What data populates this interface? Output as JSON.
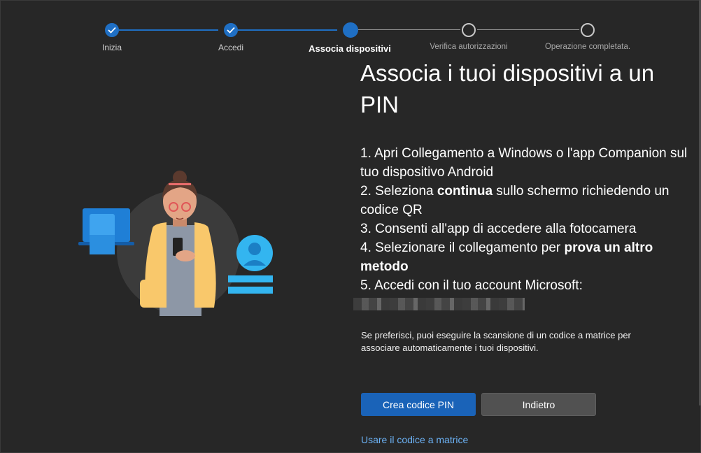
{
  "stepper": {
    "steps": [
      {
        "label": "Inizia",
        "state": "done"
      },
      {
        "label": "Accedi",
        "state": "done"
      },
      {
        "label": "Associa dispositivi",
        "state": "current"
      },
      {
        "label": "Verifica autorizzazioni",
        "state": "todo"
      },
      {
        "label": "Operazione completata.",
        "state": "todo"
      }
    ]
  },
  "main": {
    "title": "Associa i tuoi dispositivi a un PIN",
    "step1": "1. Apri Collegamento a Windows o l'app Companion sul tuo dispositivo Android",
    "step2_prefix": "2. Seleziona ",
    "step2_bold": "continua",
    "step2_suffix": " sullo schermo richiedendo un codice QR",
    "step3": "3. Consenti all'app di accedere alla fotocamera",
    "step4_prefix": "4. Selezionare il collegamento per ",
    "step4_bold": "prova un altro metodo",
    "step5": "5. Accedi con il tuo account Microsoft:",
    "note": "Se preferisci, puoi eseguire la scansione di un codice a matrice per associare automaticamente i tuoi dispositivi."
  },
  "actions": {
    "primary_label": "Crea codice PIN",
    "secondary_label": "Indietro",
    "link_label": "Usare il codice a matrice"
  },
  "colors": {
    "background": "#272727",
    "accent": "#1a63b8",
    "link": "#6cb2f5"
  }
}
